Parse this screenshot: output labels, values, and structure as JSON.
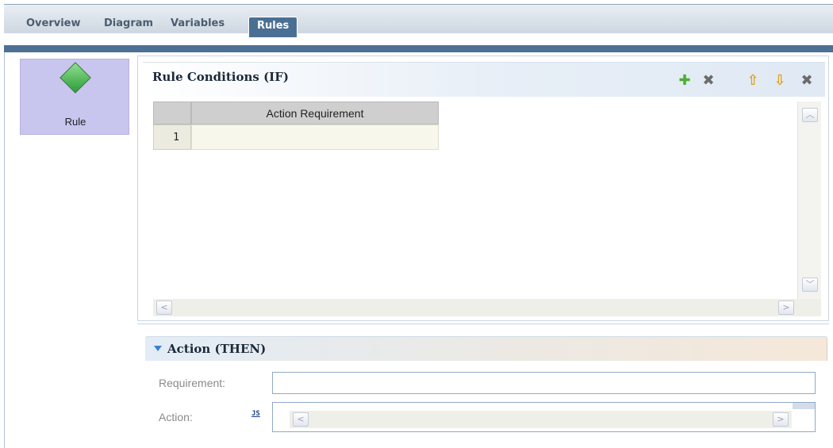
{
  "tabs": [
    {
      "label": "Overview",
      "active": false
    },
    {
      "label": "Diagram",
      "active": false
    },
    {
      "label": "Variables",
      "active": false
    },
    {
      "label": "Rules",
      "active": true
    }
  ],
  "palette": {
    "rule_label": "Rule",
    "rule_icon": "green-diamond-icon"
  },
  "conditions": {
    "title": "Rule Conditions (IF)",
    "toolbar": [
      {
        "name": "add-icon",
        "glyph": "✚",
        "color": "#4caf30"
      },
      {
        "name": "delete-icon",
        "glyph": "✖",
        "color": "#6b6b6b"
      },
      {
        "name": "move-up-icon",
        "glyph": "⇧",
        "color": "#e0a21c"
      },
      {
        "name": "move-down-icon",
        "glyph": "⇩",
        "color": "#e0a21c"
      },
      {
        "name": "remove-icon",
        "glyph": "✖",
        "color": "#6b6b6b"
      }
    ],
    "table": {
      "columns": [
        "Action Requirement"
      ],
      "rows": [
        {
          "num": "1",
          "value": ""
        }
      ]
    },
    "scroll": {
      "up": "︿",
      "down": "﹀",
      "left": "<",
      "right": ">"
    }
  },
  "action": {
    "title": "Action (THEN)",
    "requirement_label": "Requirement:",
    "requirement_value": "",
    "action_label": "Action:",
    "js_label": "JS",
    "scroll": {
      "left": "<",
      "right": ">"
    }
  },
  "colors": {
    "tab_active": "#4a6f93",
    "tab_strip": "#4d7095",
    "rule_box": "#c8c5ee"
  }
}
